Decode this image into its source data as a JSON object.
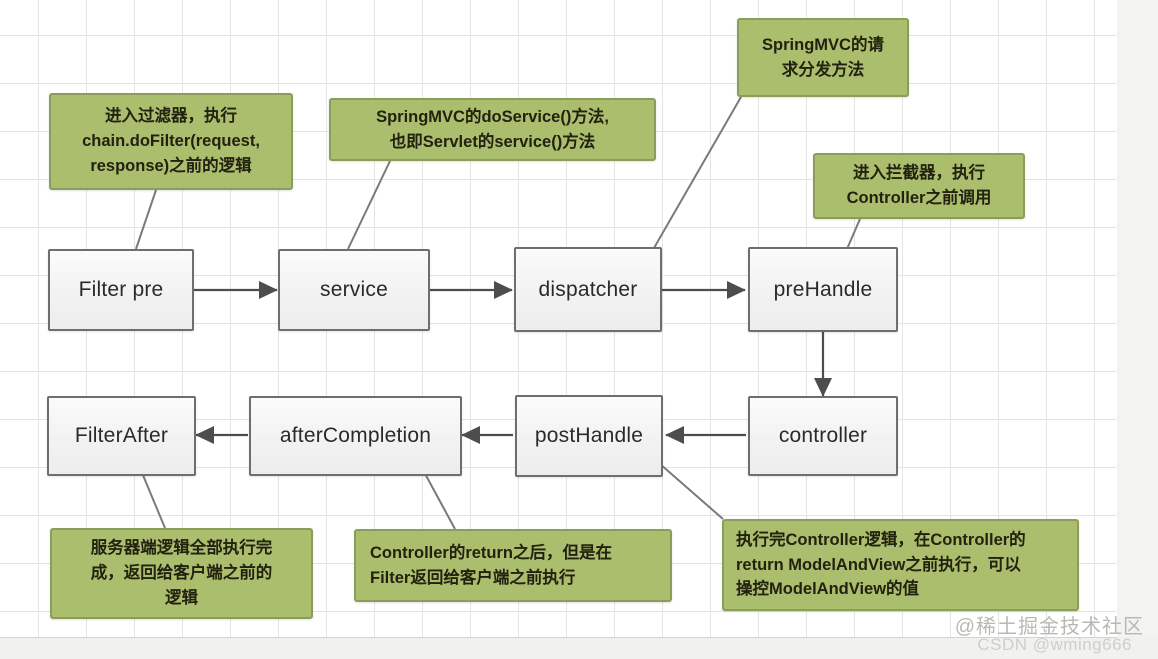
{
  "diagram": {
    "type": "flowchart",
    "title": "SpringMVC request lifecycle flow",
    "background": {
      "grid": true,
      "grid_color": "#e4e4e4",
      "canvas_color": "#ffffff"
    },
    "colors": {
      "note_fill": "#aabe6e",
      "note_border": "#8c9d5b",
      "node_fill": "#f2f2f2",
      "node_border": "#6e6e6e",
      "connector": "#6f6f6f"
    },
    "nodes": [
      {
        "id": "filter-pre",
        "label": "Filter pre"
      },
      {
        "id": "service",
        "label": "service"
      },
      {
        "id": "dispatcher",
        "label": "dispatcher"
      },
      {
        "id": "pre-handle",
        "label": "preHandle"
      },
      {
        "id": "controller",
        "label": "controller"
      },
      {
        "id": "post-handle",
        "label": "postHandle"
      },
      {
        "id": "after-completion",
        "label": "afterCompletion"
      },
      {
        "id": "filter-after",
        "label": "FilterAfter"
      }
    ],
    "notes": [
      {
        "id": "note-filter-pre",
        "text": "进入过滤器，执行\nchain.doFilter(request,\nresponse)之前的逻辑"
      },
      {
        "id": "note-service",
        "text": "SpringMVC的doService()方法,\n也即Servlet的service()方法"
      },
      {
        "id": "note-dispatcher",
        "text": "SpringMVC的请\n求分发方法"
      },
      {
        "id": "note-pre-handle",
        "text": "进入拦截器，执行\nController之前调用"
      },
      {
        "id": "note-filter-after",
        "text": "服务器端逻辑全部执行完\n成，返回给客户端之前的\n逻辑"
      },
      {
        "id": "note-after-completion",
        "text": "Controller的return之后，但是在\nFilter返回给客户端之前执行"
      },
      {
        "id": "note-post-handle",
        "text": "执行完Controller逻辑，在Controller的\nreturn ModelAndView之前执行，可以\n操控ModelAndView的值"
      }
    ],
    "edges": [
      {
        "from": "filter-pre",
        "to": "service",
        "direction": "right"
      },
      {
        "from": "service",
        "to": "dispatcher",
        "direction": "right"
      },
      {
        "from": "dispatcher",
        "to": "pre-handle",
        "direction": "right"
      },
      {
        "from": "pre-handle",
        "to": "controller",
        "direction": "down"
      },
      {
        "from": "controller",
        "to": "post-handle",
        "direction": "left"
      },
      {
        "from": "post-handle",
        "to": "after-completion",
        "direction": "left"
      },
      {
        "from": "after-completion",
        "to": "filter-after",
        "direction": "left"
      }
    ]
  },
  "watermark": {
    "primary": "@稀土掘金技术社区",
    "secondary": "CSDN @wming666"
  }
}
